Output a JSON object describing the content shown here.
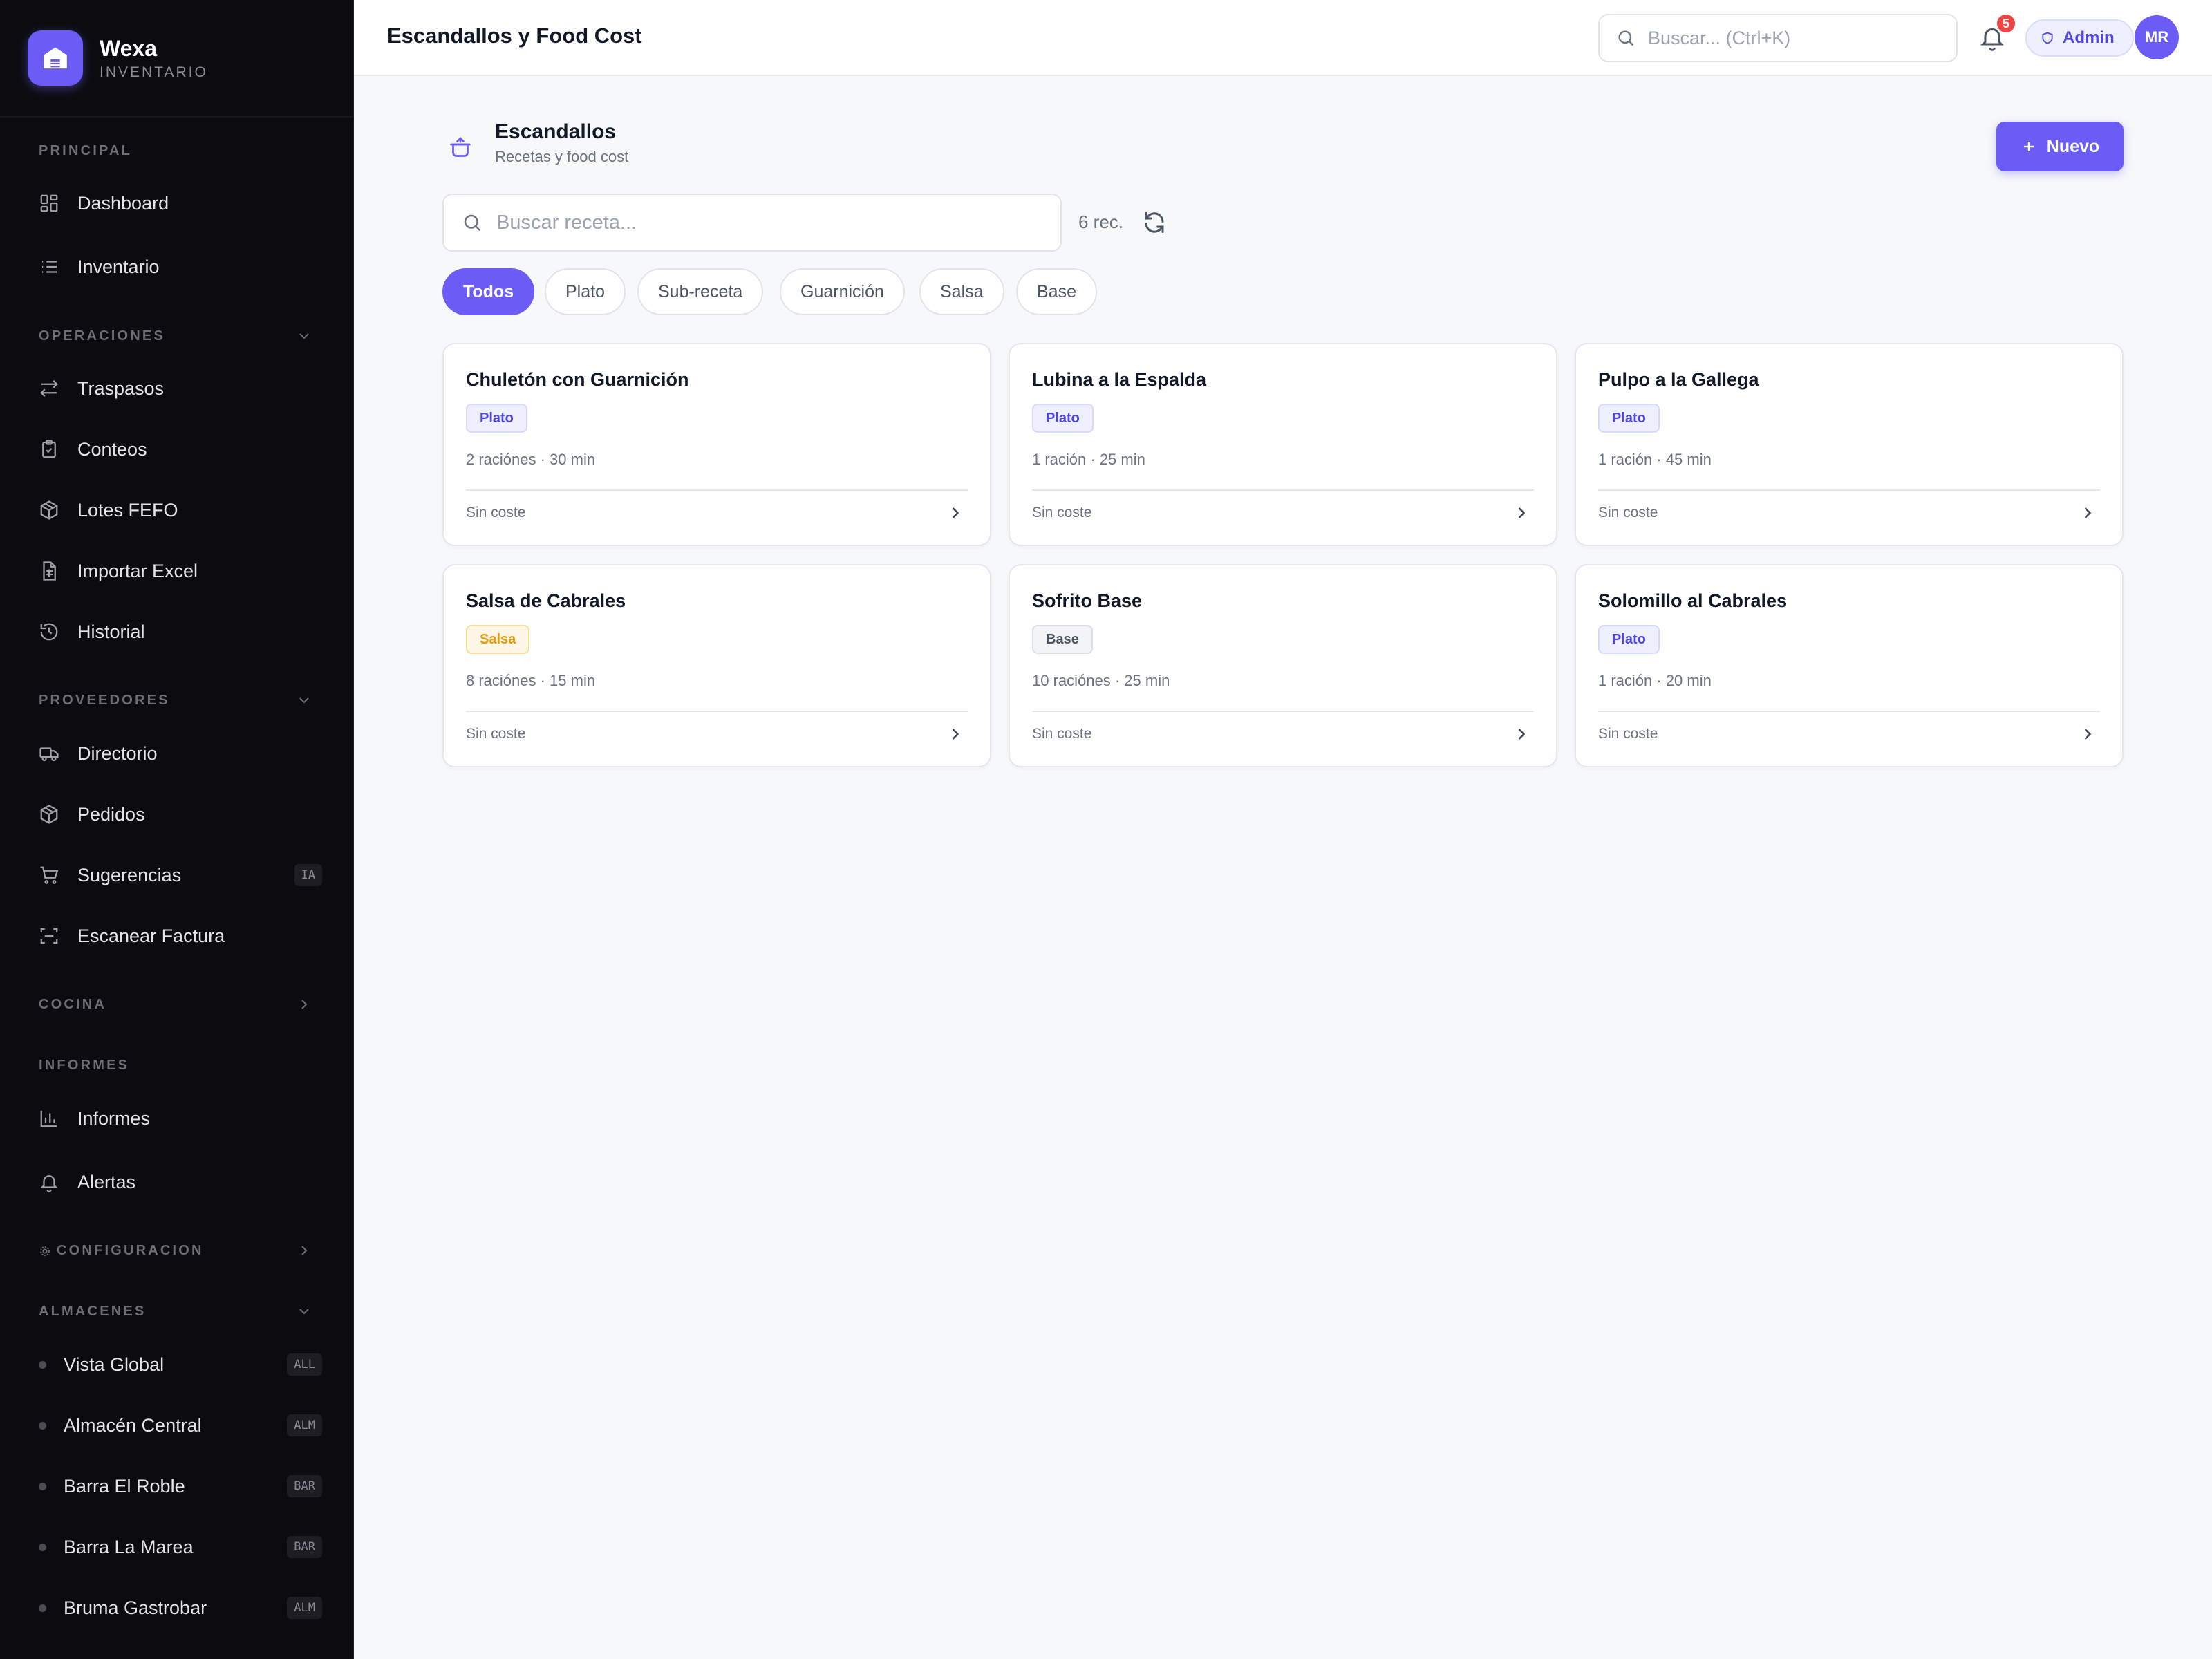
{
  "app": {
    "name": "Wexa",
    "subtitle": "INVENTARIO"
  },
  "sidebar": {
    "principal": {
      "label": "PRINCIPAL",
      "items": [
        {
          "label": "Dashboard",
          "icon": "dashboard-icon"
        },
        {
          "label": "Inventario",
          "icon": "list-icon"
        }
      ]
    },
    "operaciones": {
      "label": "OPERACIONES",
      "items": [
        {
          "label": "Traspasos",
          "icon": "transfer-icon"
        },
        {
          "label": "Conteos",
          "icon": "clipboard-icon"
        },
        {
          "label": "Lotes FEFO",
          "icon": "package-icon"
        },
        {
          "label": "Importar Excel",
          "icon": "spreadsheet-icon"
        },
        {
          "label": "Historial",
          "icon": "history-icon"
        }
      ]
    },
    "proveedores": {
      "label": "PROVEEDORES",
      "items": [
        {
          "label": "Directorio",
          "icon": "truck-icon"
        },
        {
          "label": "Pedidos",
          "icon": "package-icon"
        },
        {
          "label": "Sugerencias",
          "icon": "cart-icon",
          "badge": "IA"
        },
        {
          "label": "Escanear Factura",
          "icon": "scan-icon"
        }
      ]
    },
    "cocina": {
      "label": "COCINA"
    },
    "informes": {
      "label": "INFORMES",
      "items": [
        {
          "label": "Informes",
          "icon": "bar-chart-icon"
        },
        {
          "label": "Alertas",
          "icon": "bell-icon"
        }
      ]
    },
    "configuracion": {
      "label": "CONFIGURACION"
    },
    "almacenes": {
      "label": "ALMACENES",
      "items": [
        {
          "label": "Vista Global",
          "badge": "ALL"
        },
        {
          "label": "Almacén Central",
          "badge": "ALM"
        },
        {
          "label": "Barra El Roble",
          "badge": "BAR"
        },
        {
          "label": "Barra La Marea",
          "badge": "BAR"
        },
        {
          "label": "Bruma Gastrobar",
          "badge": "ALM"
        }
      ]
    }
  },
  "topbar": {
    "title": "Escandallos y Food Cost",
    "search_placeholder": "Buscar... (Ctrl+K)",
    "notifications_count": "5",
    "role": "Admin",
    "avatar_initials": "MR"
  },
  "page": {
    "title": "Escandallos",
    "subtitle": "Recetas y food cost",
    "new_button": "Nuevo",
    "search_placeholder": "Buscar receta...",
    "count": "6 rec."
  },
  "filters": [
    "Todos",
    "Plato",
    "Sub-receta",
    "Guarnición",
    "Salsa",
    "Base"
  ],
  "active_filter": "Todos",
  "recipes": [
    {
      "name": "Chuletón con Guarnición",
      "tag": "Plato",
      "meta": "2 raciónes · 30 min",
      "cost": "Sin coste"
    },
    {
      "name": "Lubina a la Espalda",
      "tag": "Plato",
      "meta": "1 ración · 25 min",
      "cost": "Sin coste"
    },
    {
      "name": "Pulpo a la Gallega",
      "tag": "Plato",
      "meta": "1 ración · 45 min",
      "cost": "Sin coste"
    },
    {
      "name": "Salsa de Cabrales",
      "tag": "Salsa",
      "meta": "8 raciónes · 15 min",
      "cost": "Sin coste"
    },
    {
      "name": "Sofrito Base",
      "tag": "Base",
      "meta": "10 raciónes · 25 min",
      "cost": "Sin coste"
    },
    {
      "name": "Solomillo al Cabrales",
      "tag": "Plato",
      "meta": "1 ración · 20 min",
      "cost": "Sin coste"
    }
  ],
  "colors": {
    "accent": "#6b5cf5",
    "sidebar_bg": "#0c0c10",
    "badge_red": "#ef4444",
    "tag_salsa": "#e99a0b"
  }
}
